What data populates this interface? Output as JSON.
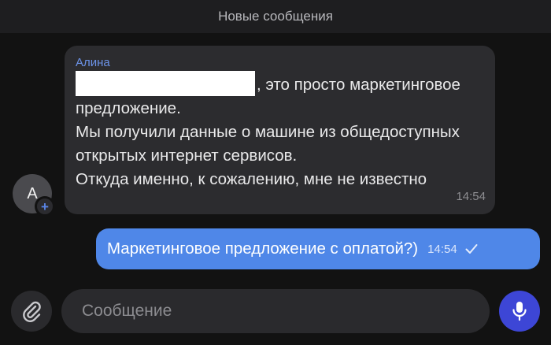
{
  "banner": {
    "title": "Новые сообщения"
  },
  "incoming": {
    "avatar_letter": "А",
    "sender": "Алина",
    "text_after_redaction": ", это просто маркетинговое предложение.\nМы получили данные о машине из общедоступных открытых интернет сервисов.\nОткуда именно, к сожалению, мне не известно",
    "time": "14:54"
  },
  "outgoing": {
    "text": "Маркетинговое предложение с оплатой?)",
    "time": "14:54"
  },
  "composer": {
    "placeholder": "Сообщение"
  },
  "colors": {
    "background": "#121212",
    "incoming_bubble": "#2c2c2f",
    "outgoing_bubble": "#4f87e8",
    "sender_name": "#6c93e8",
    "mic_button": "#3d46d6"
  },
  "icons": [
    "plus-icon",
    "check-icon",
    "paperclip-icon",
    "microphone-icon"
  ]
}
